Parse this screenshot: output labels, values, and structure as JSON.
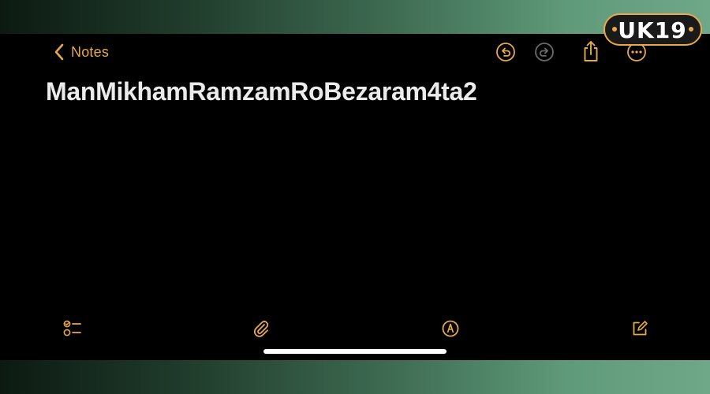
{
  "header": {
    "back_label": "Notes",
    "icons": [
      "undo-icon",
      "redo-icon",
      "share-icon",
      "more-icon"
    ]
  },
  "note": {
    "title": "ManMikhamRamzamRoBezaram4ta2"
  },
  "toolbar": {
    "icons": [
      "checklist-icon",
      "attachment-icon",
      "markup-icon",
      "compose-icon"
    ]
  },
  "watermark": {
    "text": "UK19"
  },
  "colors": {
    "accent": "#e9a84a",
    "accent_disabled": "#6b6b6b",
    "background": "#000000",
    "title_text": "#ebebeb"
  }
}
